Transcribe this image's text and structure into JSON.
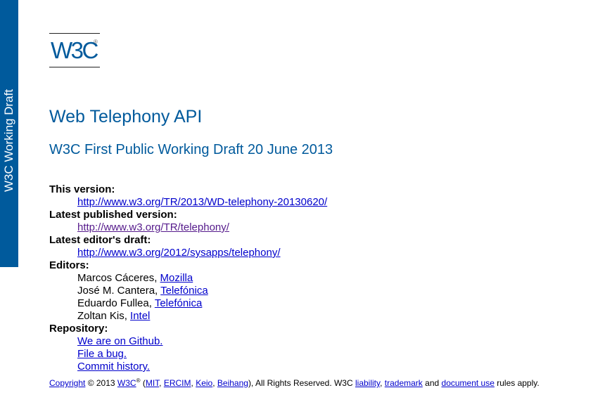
{
  "side_banner": "W3C Working Draft",
  "logo": {
    "text": "W3C",
    "reg": "®"
  },
  "title": "Web Telephony API",
  "subtitle": "W3C First Public Working Draft 20 June 2013",
  "meta": {
    "this_version": {
      "label": "This version:",
      "url": "http://www.w3.org/TR/2013/WD-telephony-20130620/"
    },
    "latest_published": {
      "label": "Latest published version:",
      "url": "http://www.w3.org/TR/telephony/"
    },
    "latest_draft": {
      "label": "Latest editor's draft:",
      "url": "http://www.w3.org/2012/sysapps/telephony/"
    },
    "editors_label": "Editors:",
    "editors": [
      {
        "name": "Marcos Cáceres, ",
        "org": "Mozilla"
      },
      {
        "name": "José M. Cantera, ",
        "org": "Telefónica"
      },
      {
        "name": "Eduardo Fullea, ",
        "org": "Telefónica"
      },
      {
        "name": "Zoltan Kis, ",
        "org": "Intel"
      }
    ],
    "repository_label": "Repository:",
    "repository": [
      "We are on Github.",
      "File a bug.",
      "Commit history."
    ]
  },
  "footer": {
    "copyright": "Copyright",
    "year": " © 2013 ",
    "w3c": "W3C",
    "reg": "®",
    "open_paren": " (",
    "mit": "MIT",
    "sep": ", ",
    "ercim": "ERCIM",
    "keio": "Keio",
    "beihang": "Beihang",
    "rights": "), All Rights Reserved. W3C ",
    "liability": "liability",
    "trademark": "trademark",
    "and": " and ",
    "document_use": "document use",
    "apply": " rules apply."
  }
}
